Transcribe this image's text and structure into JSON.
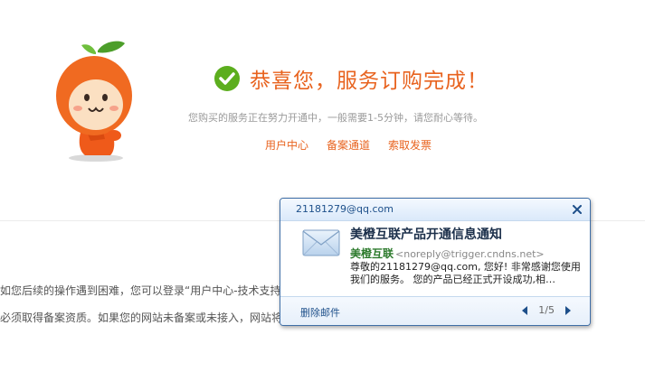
{
  "success": {
    "title": "恭喜您，服务订购完成！",
    "subtitle": "您购买的服务正在努力开通中，一般需要1-5分钟，请您耐心等待。"
  },
  "links": [
    {
      "label": "用户中心"
    },
    {
      "label": "备案通道"
    },
    {
      "label": "索取发票"
    }
  ],
  "body": {
    "line1": "如您后续的操作遇到困难，您可以登录“用户中心-技术支持",
    "line2": "必须取得备案资质。如果您的网站未备案或未接入，网站将"
  },
  "notification": {
    "account": "21181279@qq.com",
    "subject": "美橙互联产品开通信息通知",
    "sender_name": "美橙互联",
    "sender_email": "<noreply@trigger.cndns.net>",
    "preview": "尊敬的21181279@qq.com, 您好! 非常感谢您使用我们的服务。 您的产品已经正式开设成功,相…",
    "delete_label": "删除邮件",
    "page_indicator": "1/5"
  },
  "colors": {
    "accent_orange": "#e8631f",
    "success_green": "#5cae1e",
    "popup_border": "#3f6ea6"
  }
}
